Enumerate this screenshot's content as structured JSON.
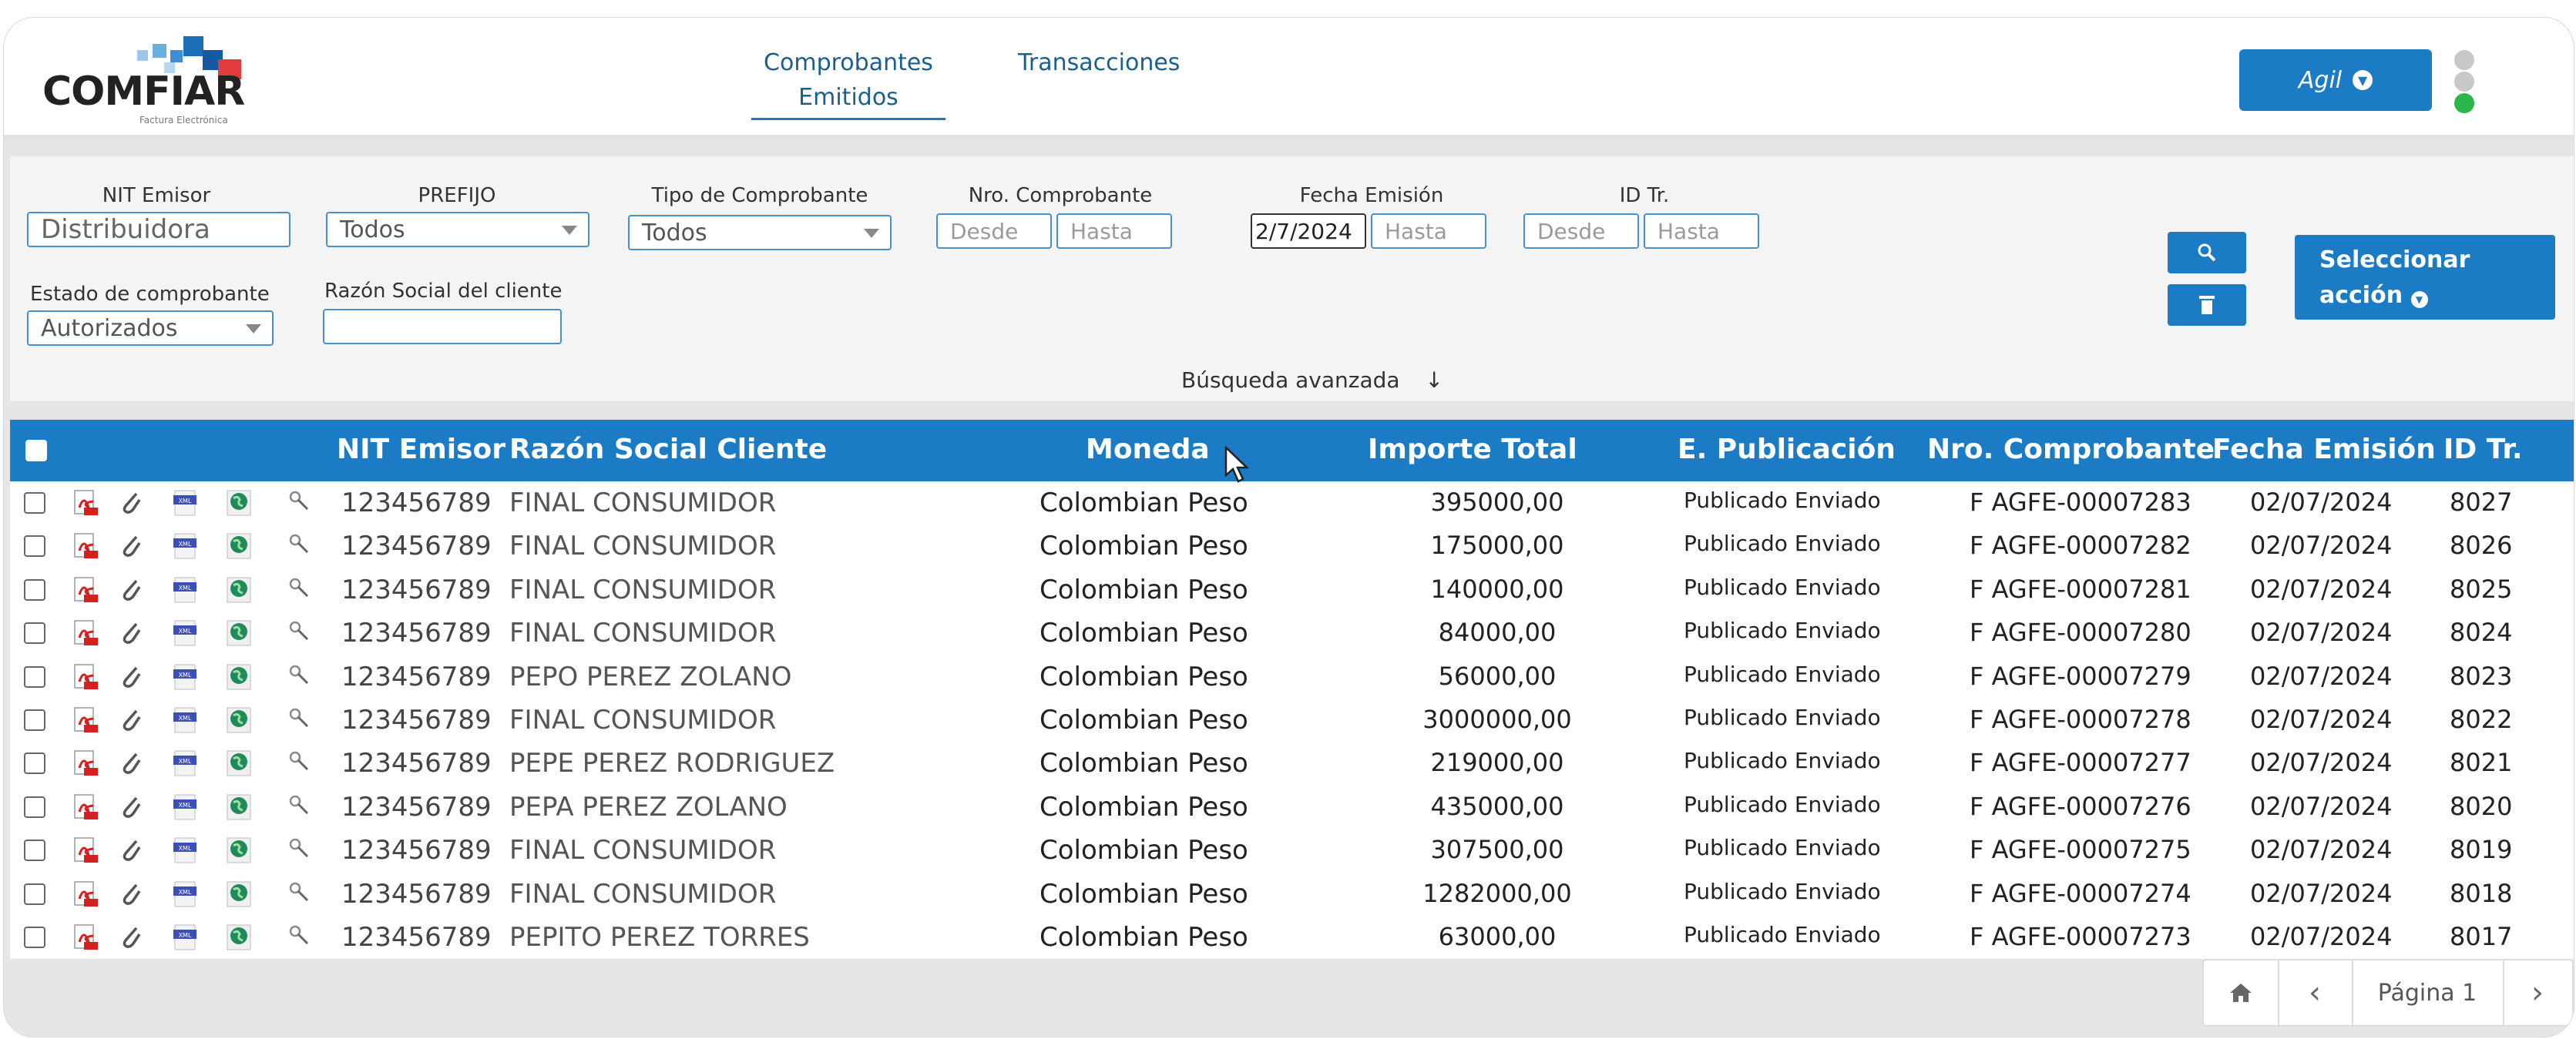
{
  "header": {
    "logo_text": "COMFIAR",
    "logo_subtitle": "Factura Electrónica",
    "nav": [
      {
        "label_line1": "Comprobantes",
        "label_line2": "Emitidos",
        "active": true
      },
      {
        "label_line1": "Transacciones",
        "active": false
      }
    ],
    "user_button": "Agil",
    "status_dots": [
      "#c8c8c8",
      "#c8c8c8",
      "#2bb54a"
    ]
  },
  "filters": {
    "nit_emisor_label": "NIT Emisor",
    "nit_emisor_value": "Distribuidora",
    "prefijo_label": "PREFIJO",
    "prefijo_value": "Todos",
    "tipo_label": "Tipo de Comprobante",
    "tipo_value": "Todos",
    "nro_label": "Nro. Comprobante",
    "nro_desde": "Desde",
    "nro_hasta": "Hasta",
    "fecha_label": "Fecha Emisión",
    "fecha_desde": "2/7/2024",
    "fecha_hasta": "Hasta",
    "idtr_label": "ID Tr.",
    "idtr_desde": "Desde",
    "idtr_hasta": "Hasta",
    "estado_label": "Estado de comprobante",
    "estado_value": "Autorizados",
    "razon_label": "Razón Social del cliente",
    "razon_value": "",
    "seleccionar_line1": "Seleccionar",
    "seleccionar_line2": "acción",
    "advanced_search": "Búsqueda avanzada",
    "advanced_arrow": "↓"
  },
  "table": {
    "columns": [
      "NIT Emisor",
      "Razón Social Cliente",
      "Moneda",
      "Importe Total",
      "E. Publicación",
      "Nro. Comprobante",
      "Fecha Emisión",
      "ID Tr."
    ],
    "rows": [
      {
        "nit": "123456789",
        "razon": "FINAL CONSUMIDOR",
        "moneda": "Colombian Peso",
        "importe": "395000,00",
        "pub": "Publicado Enviado",
        "nro": "F AGFE-00007283",
        "fecha": "02/07/2024",
        "id": "8027"
      },
      {
        "nit": "123456789",
        "razon": "FINAL CONSUMIDOR",
        "moneda": "Colombian Peso",
        "importe": "175000,00",
        "pub": "Publicado Enviado",
        "nro": "F AGFE-00007282",
        "fecha": "02/07/2024",
        "id": "8026"
      },
      {
        "nit": "123456789",
        "razon": "FINAL CONSUMIDOR",
        "moneda": "Colombian Peso",
        "importe": "140000,00",
        "pub": "Publicado Enviado",
        "nro": "F AGFE-00007281",
        "fecha": "02/07/2024",
        "id": "8025"
      },
      {
        "nit": "123456789",
        "razon": "FINAL CONSUMIDOR",
        "moneda": "Colombian Peso",
        "importe": "84000,00",
        "pub": "Publicado Enviado",
        "nro": "F AGFE-00007280",
        "fecha": "02/07/2024",
        "id": "8024"
      },
      {
        "nit": "123456789",
        "razon": "PEPO PEREZ ZOLANO",
        "moneda": "Colombian Peso",
        "importe": "56000,00",
        "pub": "Publicado Enviado",
        "nro": "F AGFE-00007279",
        "fecha": "02/07/2024",
        "id": "8023"
      },
      {
        "nit": "123456789",
        "razon": "FINAL CONSUMIDOR",
        "moneda": "Colombian Peso",
        "importe": "3000000,00",
        "pub": "Publicado Enviado",
        "nro": "F AGFE-00007278",
        "fecha": "02/07/2024",
        "id": "8022"
      },
      {
        "nit": "123456789",
        "razon": "PEPE PEREZ RODRIGUEZ",
        "moneda": "Colombian Peso",
        "importe": "219000,00",
        "pub": "Publicado Enviado",
        "nro": "F AGFE-00007277",
        "fecha": "02/07/2024",
        "id": "8021"
      },
      {
        "nit": "123456789",
        "razon": "PEPA PEREZ ZOLANO",
        "moneda": "Colombian Peso",
        "importe": "435000,00",
        "pub": "Publicado Enviado",
        "nro": "F AGFE-00007276",
        "fecha": "02/07/2024",
        "id": "8020"
      },
      {
        "nit": "123456789",
        "razon": "FINAL CONSUMIDOR",
        "moneda": "Colombian Peso",
        "importe": "307500,00",
        "pub": "Publicado Enviado",
        "nro": "F AGFE-00007275",
        "fecha": "02/07/2024",
        "id": "8019"
      },
      {
        "nit": "123456789",
        "razon": "FINAL CONSUMIDOR",
        "moneda": "Colombian Peso",
        "importe": "1282000,00",
        "pub": "Publicado Enviado",
        "nro": "F AGFE-00007274",
        "fecha": "02/07/2024",
        "id": "8018"
      },
      {
        "nit": "123456789",
        "razon": "PEPITO PEREZ TORRES",
        "moneda": "Colombian Peso",
        "importe": "63000,00",
        "pub": "Publicado Enviado",
        "nro": "F AGFE-00007273",
        "fecha": "02/07/2024",
        "id": "8017"
      }
    ],
    "row_icons": [
      "pdf-icon",
      "attachment-icon",
      "xml-icon",
      "globe-icon",
      "search-icon"
    ]
  },
  "pagination": {
    "page_label": "Página 1"
  },
  "colors": {
    "accent": "#1b7bc5",
    "nav_text": "#1b5f8c",
    "background": "#e6e6e6"
  }
}
